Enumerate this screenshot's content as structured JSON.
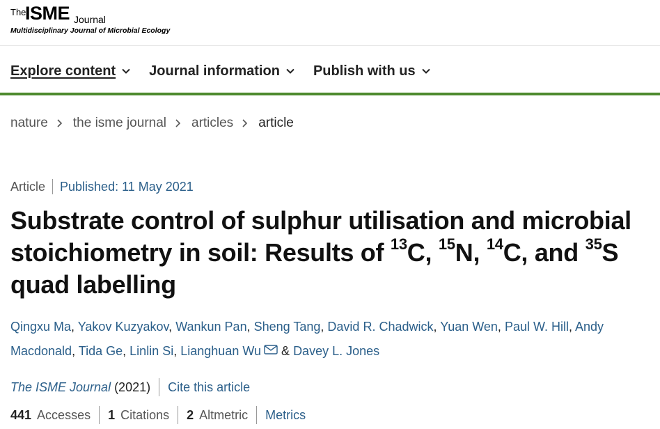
{
  "logo": {
    "the": "The",
    "isme": "ISME",
    "journal": "Journal",
    "subtitle": "Multidisciplinary Journal of Microbial Ecology"
  },
  "nav": {
    "items": [
      {
        "label": "Explore content",
        "icon": "chevron-down-icon"
      },
      {
        "label": "Journal information",
        "icon": "chevron-down-icon"
      },
      {
        "label": "Publish with us",
        "icon": "chevron-down-icon"
      }
    ]
  },
  "breadcrumb": [
    "nature",
    "the isme journal",
    "articles",
    "article"
  ],
  "article": {
    "type": "Article",
    "published": "Published: 11 May 2021",
    "title": {
      "part1": "Substrate control of sulphur utilisation and microbial stoichiometry in soil: Results of ",
      "sup1": "13",
      "part2": "C, ",
      "sup2": "15",
      "part3": "N, ",
      "sup3": "14",
      "part4": "C, and ",
      "sup4": "35",
      "part5": "S quad labelling"
    },
    "authors": [
      "Qingxu Ma",
      "Yakov Kuzyakov",
      "Wankun Pan",
      "Sheng Tang",
      "David R. Chadwick",
      "Yuan Wen",
      "Paul W. Hill",
      "Andy Macdonald",
      "Tida Ge",
      "Linlin Si",
      "Lianghuan Wu",
      "Davey L. Jones"
    ],
    "author_separator": ",",
    "author_ampersand": "&",
    "journal": "The ISME Journal",
    "year": "(2021)",
    "cite_label": "Cite this article",
    "metrics": {
      "accesses": {
        "value": "441",
        "label": "Accesses"
      },
      "citations": {
        "value": "1",
        "label": "Citations"
      },
      "altmetric": {
        "value": "2",
        "label": "Altmetric"
      },
      "link": "Metrics"
    }
  },
  "colors": {
    "link": "#2b5f8a",
    "accent_rule": "#4e8a2e",
    "text": "#222222"
  }
}
